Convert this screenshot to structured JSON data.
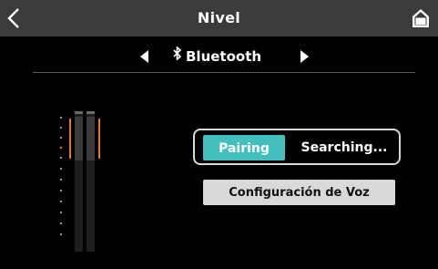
{
  "header": {
    "title": "Nivel",
    "back_icon": "back-chevron-icon",
    "home_icon": "home-icon"
  },
  "source": {
    "label": "Bluetooth",
    "icon": "bluetooth-icon",
    "prev_icon": "triangle-left-icon",
    "next_icon": "triangle-right-icon"
  },
  "pairing": {
    "button_label": "Pairing",
    "status_text": "Searching..."
  },
  "voice": {
    "button_label": "Configuración de Voz"
  },
  "colors": {
    "accent": "#43bfc0",
    "header_bg": "#3b3b3b",
    "meter_peak": "#e07a2a",
    "secondary_button": "#d9d9d9"
  }
}
